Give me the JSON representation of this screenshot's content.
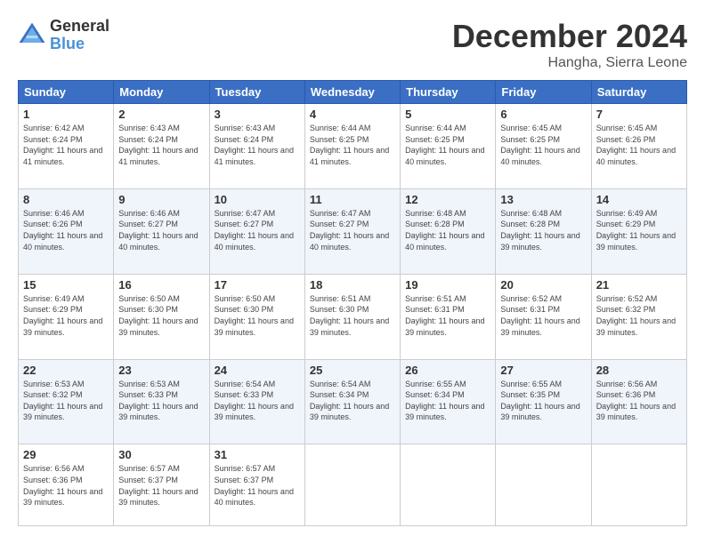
{
  "logo": {
    "general": "General",
    "blue": "Blue"
  },
  "title": {
    "month": "December 2024",
    "location": "Hangha, Sierra Leone"
  },
  "headers": [
    "Sunday",
    "Monday",
    "Tuesday",
    "Wednesday",
    "Thursday",
    "Friday",
    "Saturday"
  ],
  "weeks": [
    [
      {
        "day": "1",
        "sunrise": "6:42 AM",
        "sunset": "6:24 PM",
        "daylight": "11 hours and 41 minutes."
      },
      {
        "day": "2",
        "sunrise": "6:43 AM",
        "sunset": "6:24 PM",
        "daylight": "11 hours and 41 minutes."
      },
      {
        "day": "3",
        "sunrise": "6:43 AM",
        "sunset": "6:24 PM",
        "daylight": "11 hours and 41 minutes."
      },
      {
        "day": "4",
        "sunrise": "6:44 AM",
        "sunset": "6:25 PM",
        "daylight": "11 hours and 41 minutes."
      },
      {
        "day": "5",
        "sunrise": "6:44 AM",
        "sunset": "6:25 PM",
        "daylight": "11 hours and 40 minutes."
      },
      {
        "day": "6",
        "sunrise": "6:45 AM",
        "sunset": "6:25 PM",
        "daylight": "11 hours and 40 minutes."
      },
      {
        "day": "7",
        "sunrise": "6:45 AM",
        "sunset": "6:26 PM",
        "daylight": "11 hours and 40 minutes."
      }
    ],
    [
      {
        "day": "8",
        "sunrise": "6:46 AM",
        "sunset": "6:26 PM",
        "daylight": "11 hours and 40 minutes."
      },
      {
        "day": "9",
        "sunrise": "6:46 AM",
        "sunset": "6:27 PM",
        "daylight": "11 hours and 40 minutes."
      },
      {
        "day": "10",
        "sunrise": "6:47 AM",
        "sunset": "6:27 PM",
        "daylight": "11 hours and 40 minutes."
      },
      {
        "day": "11",
        "sunrise": "6:47 AM",
        "sunset": "6:27 PM",
        "daylight": "11 hours and 40 minutes."
      },
      {
        "day": "12",
        "sunrise": "6:48 AM",
        "sunset": "6:28 PM",
        "daylight": "11 hours and 40 minutes."
      },
      {
        "day": "13",
        "sunrise": "6:48 AM",
        "sunset": "6:28 PM",
        "daylight": "11 hours and 39 minutes."
      },
      {
        "day": "14",
        "sunrise": "6:49 AM",
        "sunset": "6:29 PM",
        "daylight": "11 hours and 39 minutes."
      }
    ],
    [
      {
        "day": "15",
        "sunrise": "6:49 AM",
        "sunset": "6:29 PM",
        "daylight": "11 hours and 39 minutes."
      },
      {
        "day": "16",
        "sunrise": "6:50 AM",
        "sunset": "6:30 PM",
        "daylight": "11 hours and 39 minutes."
      },
      {
        "day": "17",
        "sunrise": "6:50 AM",
        "sunset": "6:30 PM",
        "daylight": "11 hours and 39 minutes."
      },
      {
        "day": "18",
        "sunrise": "6:51 AM",
        "sunset": "6:30 PM",
        "daylight": "11 hours and 39 minutes."
      },
      {
        "day": "19",
        "sunrise": "6:51 AM",
        "sunset": "6:31 PM",
        "daylight": "11 hours and 39 minutes."
      },
      {
        "day": "20",
        "sunrise": "6:52 AM",
        "sunset": "6:31 PM",
        "daylight": "11 hours and 39 minutes."
      },
      {
        "day": "21",
        "sunrise": "6:52 AM",
        "sunset": "6:32 PM",
        "daylight": "11 hours and 39 minutes."
      }
    ],
    [
      {
        "day": "22",
        "sunrise": "6:53 AM",
        "sunset": "6:32 PM",
        "daylight": "11 hours and 39 minutes."
      },
      {
        "day": "23",
        "sunrise": "6:53 AM",
        "sunset": "6:33 PM",
        "daylight": "11 hours and 39 minutes."
      },
      {
        "day": "24",
        "sunrise": "6:54 AM",
        "sunset": "6:33 PM",
        "daylight": "11 hours and 39 minutes."
      },
      {
        "day": "25",
        "sunrise": "6:54 AM",
        "sunset": "6:34 PM",
        "daylight": "11 hours and 39 minutes."
      },
      {
        "day": "26",
        "sunrise": "6:55 AM",
        "sunset": "6:34 PM",
        "daylight": "11 hours and 39 minutes."
      },
      {
        "day": "27",
        "sunrise": "6:55 AM",
        "sunset": "6:35 PM",
        "daylight": "11 hours and 39 minutes."
      },
      {
        "day": "28",
        "sunrise": "6:56 AM",
        "sunset": "6:36 PM",
        "daylight": "11 hours and 39 minutes."
      }
    ],
    [
      {
        "day": "29",
        "sunrise": "6:56 AM",
        "sunset": "6:36 PM",
        "daylight": "11 hours and 39 minutes."
      },
      {
        "day": "30",
        "sunrise": "6:57 AM",
        "sunset": "6:37 PM",
        "daylight": "11 hours and 39 minutes."
      },
      {
        "day": "31",
        "sunrise": "6:57 AM",
        "sunset": "6:37 PM",
        "daylight": "11 hours and 40 minutes."
      },
      null,
      null,
      null,
      null
    ]
  ]
}
